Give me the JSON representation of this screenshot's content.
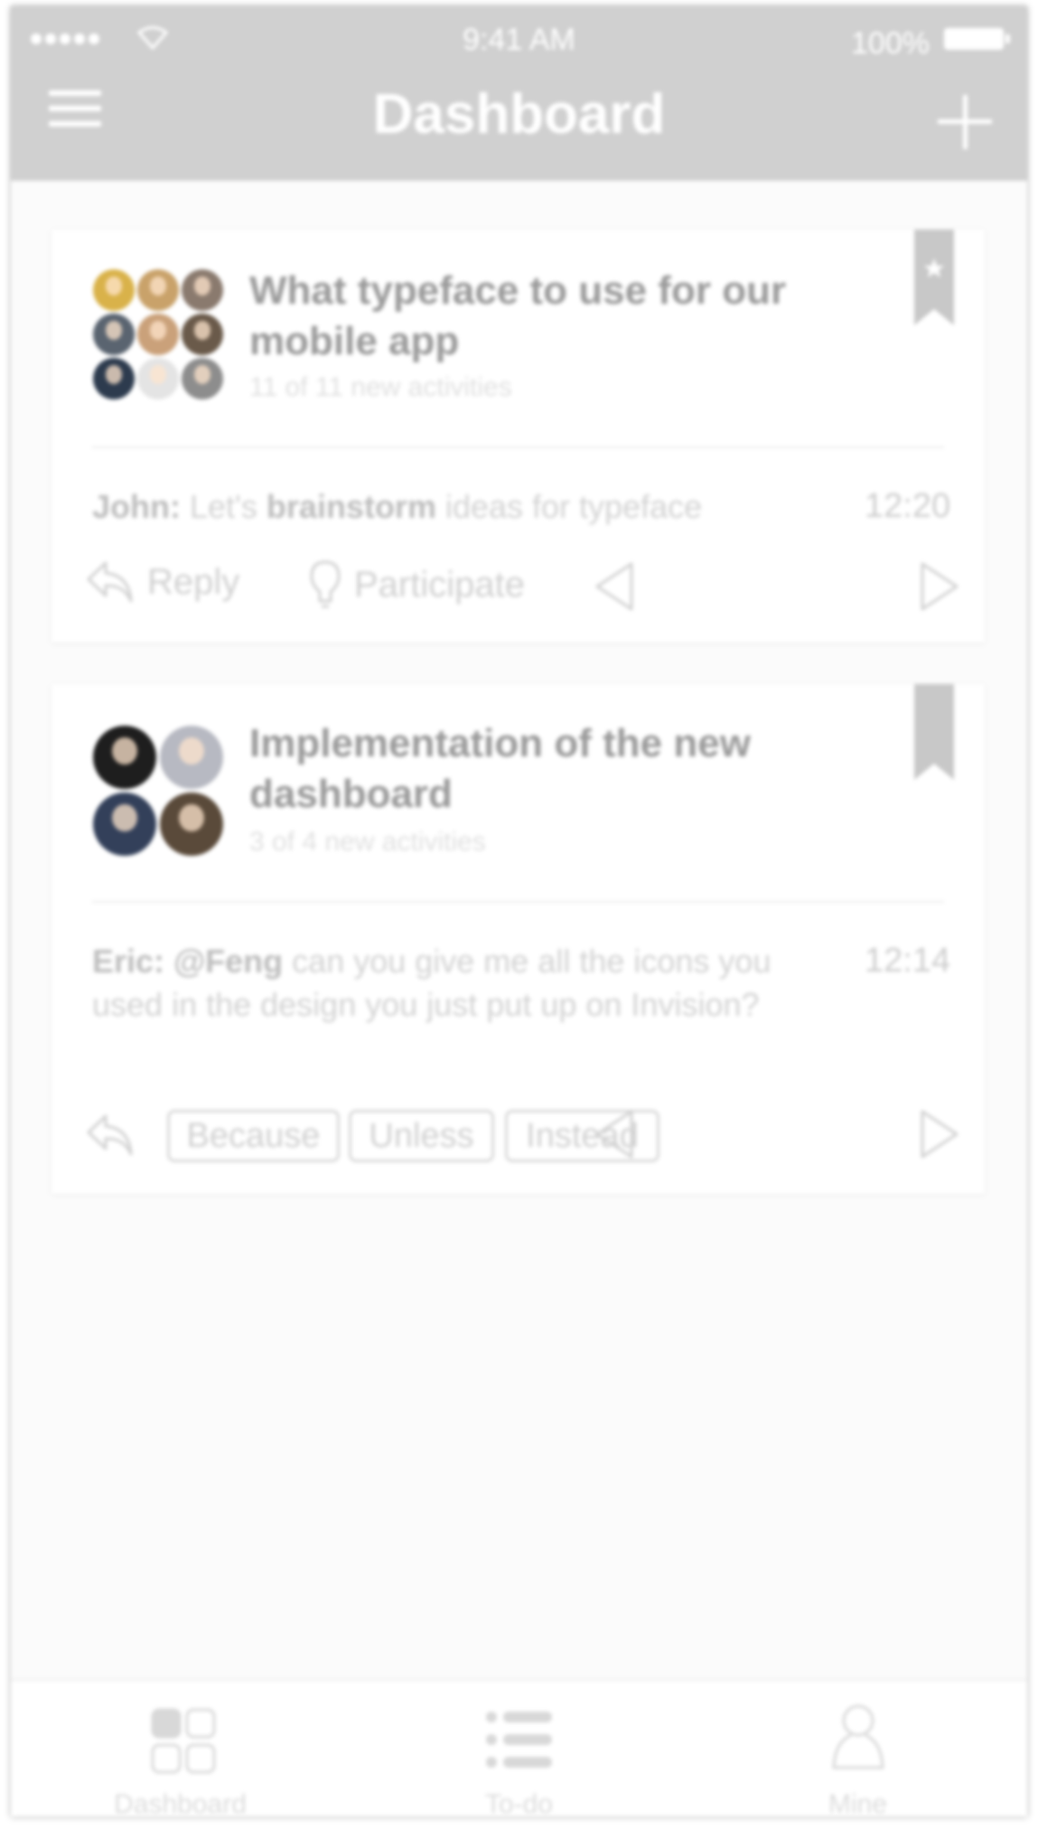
{
  "status_bar": {
    "time": "9:41 AM",
    "battery": "100%"
  },
  "header": {
    "title": "Dashboard",
    "menu_icon": "hamburger-icon",
    "add_icon": "plus-icon"
  },
  "cards": [
    {
      "title": "What typeface to use for our mobile app",
      "subtitle": "11 of 11 new activities",
      "bookmarked": true,
      "message": {
        "author": "John:",
        "pre": "Let's ",
        "bold": "brainstorm",
        "post": " ideas for typeface"
      },
      "time": "12:20",
      "actions": {
        "reply": "Reply",
        "participate": "Participate"
      }
    },
    {
      "title": "Implementation of the new dashboard",
      "subtitle": "3 of 4 new activities",
      "bookmarked": false,
      "message": {
        "author": "Eric:",
        "mention": "@Feng",
        "text": " can you give me all the icons you used in the design you just put up on Invision?"
      },
      "time": "12:14",
      "tags": [
        "Because",
        "Unless",
        "Instead"
      ]
    }
  ],
  "tabbar": {
    "items": [
      "Dashboard",
      "To-do",
      "Mine"
    ]
  },
  "colors": {
    "header": "#d0d0d0",
    "background": "#fbfbfb",
    "card": "#ffffff"
  }
}
